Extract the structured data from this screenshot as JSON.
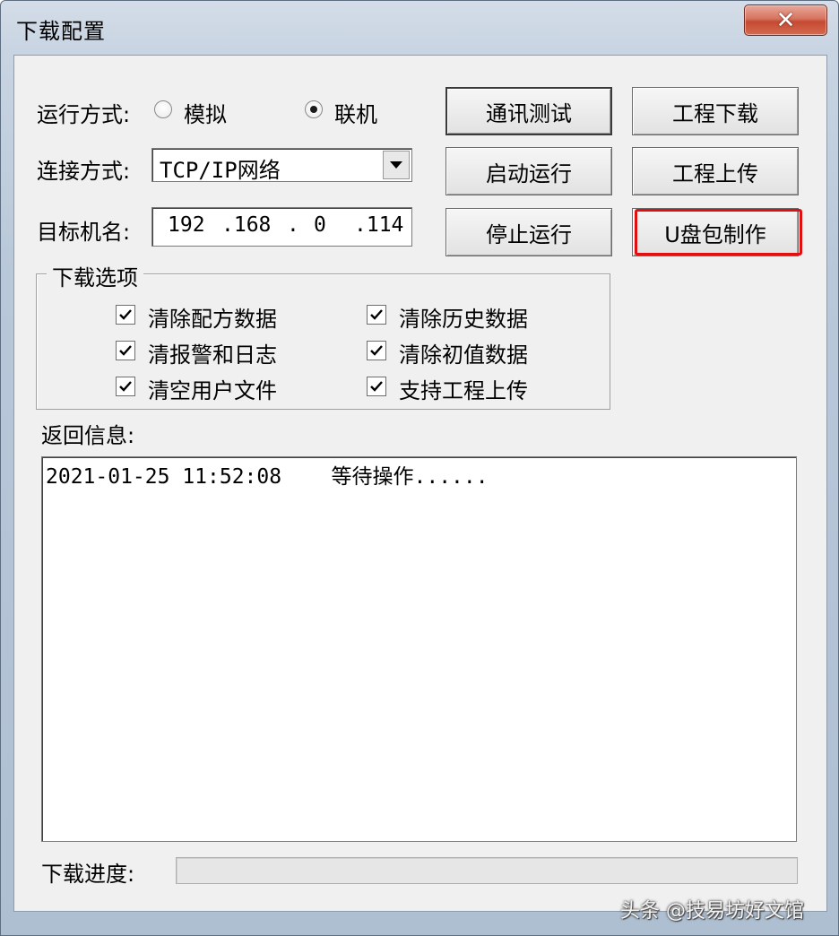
{
  "window": {
    "title": "下载配置"
  },
  "run_mode": {
    "label": "运行方式:",
    "options": [
      {
        "label": "模拟",
        "checked": false
      },
      {
        "label": "联机",
        "checked": true
      }
    ]
  },
  "connect_mode": {
    "label": "连接方式:",
    "value": "TCP/IP网络"
  },
  "target": {
    "label": "目标机名:",
    "ip": [
      "192",
      ".168",
      ".",
      "0",
      ".114"
    ]
  },
  "buttons": {
    "comm_test": "通讯测试",
    "project_download": "工程下载",
    "start_run": "启动运行",
    "project_upload": "工程上传",
    "stop_run": "停止运行",
    "usb_package": "U盘包制作"
  },
  "download_options": {
    "title": "下载选项",
    "items": [
      {
        "label": "清除配方数据",
        "checked": true
      },
      {
        "label": "清除历史数据",
        "checked": true
      },
      {
        "label": "清报警和日志",
        "checked": true
      },
      {
        "label": "清除初值数据",
        "checked": true
      },
      {
        "label": "清空用户文件",
        "checked": true
      },
      {
        "label": "支持工程上传",
        "checked": true
      }
    ]
  },
  "return_info": {
    "label": "返回信息:",
    "log": [
      {
        "time": "2021-01-25 11:52:08",
        "message": "等待操作......"
      }
    ]
  },
  "progress": {
    "label": "下载进度:",
    "value": 0
  },
  "watermark": "头条 @技易坊好文馆"
}
